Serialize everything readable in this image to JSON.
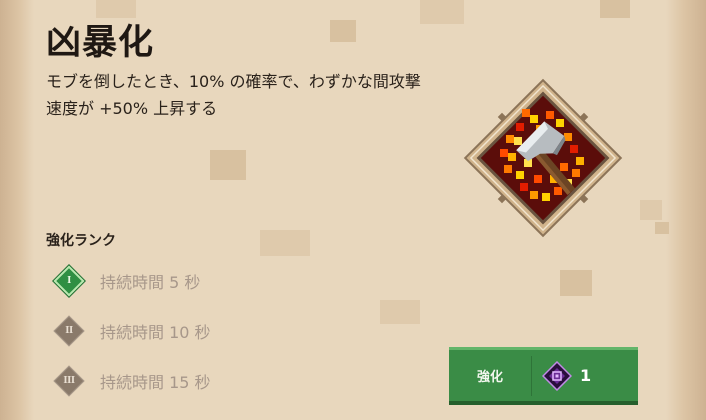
{
  "enchantment": {
    "name": "凶暴化",
    "description": "モブを倒したとき、10% の確率で、わずかな間攻撃速度が +50% 上昇する",
    "icon": "axe-on-fire-icon"
  },
  "rank": {
    "heading": "強化ランク",
    "tiers": [
      {
        "numeral": "I",
        "label": "持続時間 5 秒",
        "active": true
      },
      {
        "numeral": "II",
        "label": "持続時間 10 秒",
        "active": false
      },
      {
        "numeral": "III",
        "label": "持続時間 15 秒",
        "active": false
      }
    ]
  },
  "enchant_button": {
    "label": "強化",
    "cost": "1",
    "cost_icon": "enchantment-point-icon"
  },
  "colors": {
    "parchment": "#e8d7bd",
    "button_green": "#3a8c46",
    "active_tier": "#2f8f43",
    "inactive_tier": "#8a7a6a"
  }
}
